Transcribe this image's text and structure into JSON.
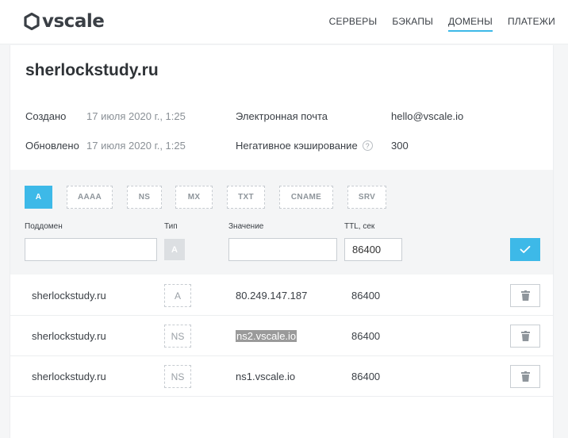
{
  "brand": {
    "name": "vscale",
    "accent_color": "#3db9e8"
  },
  "nav": {
    "items": [
      {
        "label": "СЕРВЕРЫ",
        "active": false
      },
      {
        "label": "БЭКАПЫ",
        "active": false
      },
      {
        "label": "ДОМЕНЫ",
        "active": true
      },
      {
        "label": "ПЛАТЕЖИ",
        "active": false
      }
    ]
  },
  "domain": {
    "title": "sherlockstudy.ru",
    "created_label": "Создано",
    "created_value": "17 июля 2020 г., 1:25",
    "updated_label": "Обновлено",
    "updated_value": "17 июля 2020 г., 1:25",
    "email_label": "Электронная почта",
    "email_value": "hello@vscale.io",
    "neg_cache_label": "Негативное кэширование",
    "neg_cache_help": "?",
    "neg_cache_value": "300"
  },
  "record_form": {
    "types": [
      {
        "label": "A",
        "active": true
      },
      {
        "label": "AAAA",
        "active": false
      },
      {
        "label": "NS",
        "active": false
      },
      {
        "label": "MX",
        "active": false
      },
      {
        "label": "TXT",
        "active": false
      },
      {
        "label": "CNAME",
        "active": false
      },
      {
        "label": "SRV",
        "active": false
      }
    ],
    "subdomain_label": "Поддомен",
    "subdomain_value": "",
    "type_label": "Тип",
    "type_value": "A",
    "value_label": "Значение",
    "value_value": "",
    "ttl_label": "TTL, сек",
    "ttl_value": "86400"
  },
  "records": [
    {
      "name": "sherlockstudy.ru",
      "type": "A",
      "value": "80.249.147.187",
      "ttl": "86400",
      "highlighted": false
    },
    {
      "name": "sherlockstudy.ru",
      "type": "NS",
      "value": "ns2.vscale.io",
      "ttl": "86400",
      "highlighted": true
    },
    {
      "name": "sherlockstudy.ru",
      "type": "NS",
      "value": "ns1.vscale.io",
      "ttl": "86400",
      "highlighted": false
    }
  ]
}
